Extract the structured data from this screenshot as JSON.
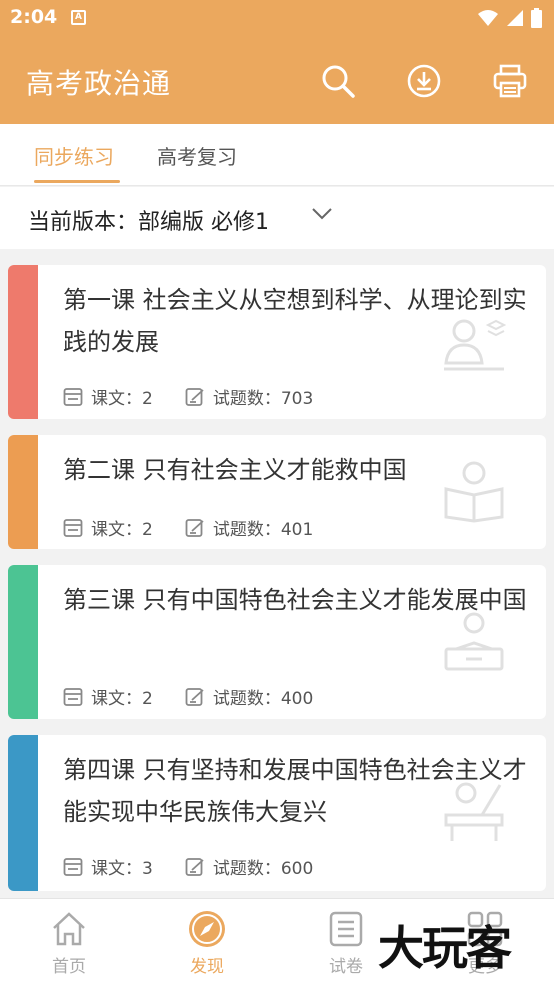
{
  "status_bar": {
    "time": "2:04",
    "notif_letter": "A"
  },
  "appbar": {
    "title": "高考政治通",
    "icons": [
      "search-icon",
      "download-icon",
      "print-icon"
    ],
    "color": "#eba85e"
  },
  "tabs": [
    {
      "label": "同步练习",
      "active": true
    },
    {
      "label": "高考复习",
      "active": false
    }
  ],
  "version": {
    "text": "当前版本：部编版 必修1"
  },
  "cards": [
    {
      "title": "第一课 社会主义从空想到科学、从理论到实践的发展",
      "lessons_label": "课文：2",
      "questions_label": "试题数：703",
      "color": "#ee7a6c"
    },
    {
      "title": "第二课 只有社会主义才能救中国",
      "lessons_label": "课文：2",
      "questions_label": "试题数：401",
      "color": "#ec9d52"
    },
    {
      "title": "第三课 只有中国特色社会主义才能发展中国",
      "lessons_label": "课文：2",
      "questions_label": "试题数：400",
      "color": "#4cc493"
    },
    {
      "title": "第四课 只有坚持和发展中国特色社会主义才能实现中华民族伟大复兴",
      "lessons_label": "课文：3",
      "questions_label": "试题数：600",
      "color": "#3b98c6"
    }
  ],
  "bottom_nav": [
    {
      "label": "首页",
      "icon": "home-icon",
      "active": false
    },
    {
      "label": "发现",
      "icon": "compass-icon",
      "active": true
    },
    {
      "label": "试卷",
      "icon": "paper-icon",
      "active": false
    },
    {
      "label": "更多",
      "icon": "grid-icon",
      "active": false
    }
  ],
  "watermark": "大玩客"
}
